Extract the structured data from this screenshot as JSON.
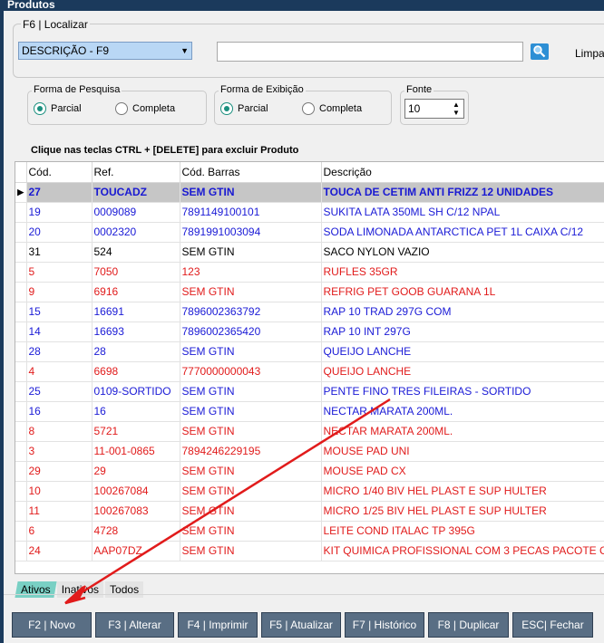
{
  "window": {
    "title": "Produtos"
  },
  "search": {
    "legend": "F6 | Localizar",
    "field_selected": "DESCRIÇÃO -  F9",
    "input_value": "",
    "clear_label": "Limpa"
  },
  "forma_pesquisa": {
    "legend": "Forma de Pesquisa",
    "options": [
      "Parcial",
      "Completa"
    ],
    "selected": "Parcial"
  },
  "forma_exibicao": {
    "legend": "Forma de Exibição",
    "options": [
      "Parcial",
      "Completa"
    ],
    "selected": "Parcial"
  },
  "fonte": {
    "legend": "Fonte",
    "value": "10"
  },
  "hint": "Clique nas teclas CTRL + [DELETE] para excluir Produto",
  "grid": {
    "columns": [
      "Cód.",
      "Ref.",
      "Cód. Barras",
      "Descrição"
    ],
    "rows": [
      {
        "cod": "27",
        "ref": "TOUCADZ",
        "barras": "SEM GTIN",
        "desc": "TOUCA DE CETIM ANTI FRIZZ 12 UNIDADES",
        "color": "sel"
      },
      {
        "cod": "19",
        "ref": "0009089",
        "barras": "7891149100101",
        "desc": "SUKITA LATA 350ML SH C/12 NPAL",
        "color": "blue"
      },
      {
        "cod": "20",
        "ref": "0002320",
        "barras": "7891991003094",
        "desc": "SODA LIMONADA ANTARCTICA PET 1L CAIXA C/12",
        "color": "blue"
      },
      {
        "cod": "31",
        "ref": "524",
        "barras": "SEM GTIN",
        "desc": "SACO NYLON VAZIO",
        "color": "black"
      },
      {
        "cod": "5",
        "ref": "7050",
        "barras": "123",
        "desc": "RUFLES 35GR",
        "color": "red"
      },
      {
        "cod": "9",
        "ref": "6916",
        "barras": "SEM GTIN",
        "desc": "REFRIG PET GOOB GUARANA 1L",
        "color": "red"
      },
      {
        "cod": "15",
        "ref": "16691",
        "barras": "7896002363792",
        "desc": "RAP 10 TRAD 297G COM",
        "color": "blue"
      },
      {
        "cod": "14",
        "ref": "16693",
        "barras": "7896002365420",
        "desc": "RAP 10 INT 297G",
        "color": "blue"
      },
      {
        "cod": "28",
        "ref": "28",
        "barras": "SEM GTIN",
        "desc": "QUEIJO LANCHE",
        "color": "blue"
      },
      {
        "cod": "4",
        "ref": "6698",
        "barras": "7770000000043",
        "desc": "QUEIJO LANCHE",
        "color": "red"
      },
      {
        "cod": "25",
        "ref": "0109-SORTIDO",
        "barras": "SEM GTIN",
        "desc": "PENTE FINO TRES FILEIRAS - SORTIDO",
        "color": "blue"
      },
      {
        "cod": "16",
        "ref": "16",
        "barras": "SEM GTIN",
        "desc": "NECTAR MARATA 200ML.",
        "color": "blue"
      },
      {
        "cod": "8",
        "ref": "5721",
        "barras": "SEM GTIN",
        "desc": "NECTAR MARATA 200ML.",
        "color": "red"
      },
      {
        "cod": "3",
        "ref": "11-001-0865",
        "barras": "7894246229195",
        "desc": "MOUSE PAD  UNI",
        "color": "red"
      },
      {
        "cod": "29",
        "ref": "29",
        "barras": "SEM GTIN",
        "desc": "MOUSE PAD  CX",
        "color": "red"
      },
      {
        "cod": "10",
        "ref": "100267084",
        "barras": "SEM GTIN",
        "desc": "MICRO 1/40 BIV HEL PLAST E SUP HULTER",
        "color": "red"
      },
      {
        "cod": "11",
        "ref": "100267083",
        "barras": "SEM GTIN",
        "desc": "MICRO 1/25 BIV HEL PLAST E SUP HULTER",
        "color": "red"
      },
      {
        "cod": "6",
        "ref": "4728",
        "barras": "SEM GTIN",
        "desc": "LEITE COND ITALAC TP 395G",
        "color": "red"
      },
      {
        "cod": "24",
        "ref": "AAP07DZ",
        "barras": "SEM GTIN",
        "desc": "KIT QUIMICA PROFISSIONAL COM 3 PECAS PACOTE C",
        "color": "red"
      }
    ]
  },
  "tabs": [
    "Ativos",
    "Inativos",
    "Todos"
  ],
  "active_tab": "Ativos",
  "buttons": {
    "novo": "F2 | Novo",
    "alterar": "F3 | Alterar",
    "imprimir": "F4 | Imprimir",
    "atualizar": "F5 | Atualizar",
    "historico": "F7 | Histórico",
    "duplicar": "F8 | Duplicar",
    "fechar": "ESC| Fechar"
  },
  "colors": {
    "selected_row": "#c6c6c6",
    "blue_text": "#1a1ad6",
    "red_text": "#e11b1b",
    "button_bg": "#596e84",
    "annotation_arrow": "#e11b1b"
  }
}
